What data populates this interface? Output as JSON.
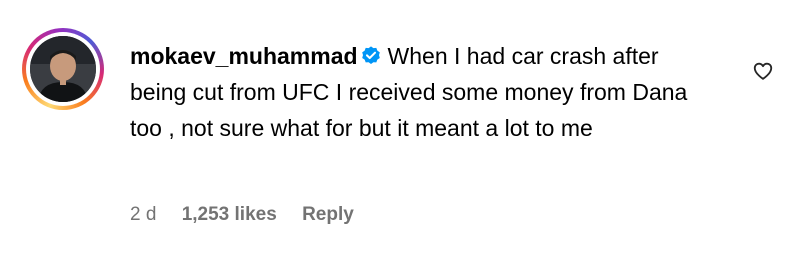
{
  "comment": {
    "username": "mokaev_muhammad",
    "verified": true,
    "text": "When I had car crash after being cut from UFC I received some money from Dana too , not sure what for but it meant a lot to me",
    "timestamp": "2 d",
    "likes": "1,253 likes",
    "reply_label": "Reply"
  },
  "icons": {
    "avatar_ring": "story-ring-gradient",
    "verified": "verified-badge-icon",
    "like": "heart-outline-icon"
  },
  "colors": {
    "verified_blue": "#0095f6",
    "meta_gray": "#737373",
    "text": "#000000"
  }
}
